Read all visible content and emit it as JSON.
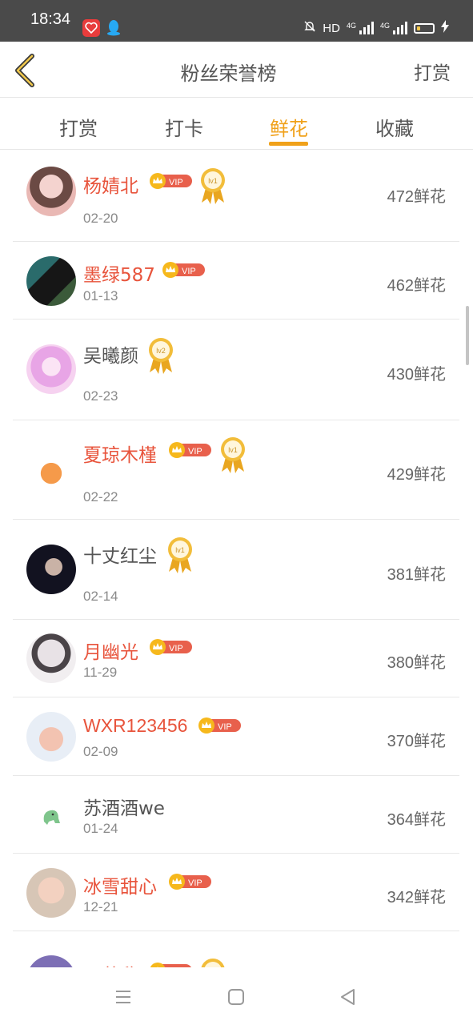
{
  "status_bar": {
    "time": "18:34",
    "hd_label": "HD",
    "signal1_label": "4G",
    "signal2_label": "4G",
    "icons": [
      "app-badge-icon",
      "qq-icon",
      "mute-bell-icon",
      "signal-icon",
      "battery-icon",
      "charging-icon"
    ]
  },
  "header": {
    "title": "粉丝荣誉榜",
    "action_label": "打赏",
    "back_icon": "chevron-left-icon"
  },
  "tabs": [
    {
      "label": "打赏",
      "active": false
    },
    {
      "label": "打卡",
      "active": false
    },
    {
      "label": "鲜花",
      "active": true
    },
    {
      "label": "收藏",
      "active": false
    }
  ],
  "accent_color": "#f0a11a",
  "vip_name_color": "#e8543c",
  "vip_badge_label": "VIP",
  "unit": "鲜花",
  "fans": [
    {
      "name": "杨婧北",
      "date": "02-20",
      "count": "472",
      "vip": true,
      "medal": "lv1"
    },
    {
      "name": "墨绿587",
      "date": "01-13",
      "count": "462",
      "vip": true,
      "medal": ""
    },
    {
      "name": "吴曦颜",
      "date": "02-23",
      "count": "430",
      "vip": false,
      "medal": "lv2"
    },
    {
      "name": "夏琼木槿",
      "date": "02-22",
      "count": "429",
      "vip": true,
      "medal": "lv1"
    },
    {
      "name": "十丈红尘",
      "date": "02-14",
      "count": "381",
      "vip": false,
      "medal": "lv1"
    },
    {
      "name": "月幽光",
      "date": "11-29",
      "count": "380",
      "vip": true,
      "medal": ""
    },
    {
      "name": "WXR123456",
      "date": "02-09",
      "count": "370",
      "vip": true,
      "medal": ""
    },
    {
      "name": "苏酒酒we",
      "date": "01-24",
      "count": "364",
      "vip": false,
      "medal": ""
    },
    {
      "name": "冰雪甜心",
      "date": "12-21",
      "count": "342",
      "vip": true,
      "medal": ""
    },
    {
      "name": "田苏欣",
      "date": "",
      "count": "",
      "vip": true,
      "medal": "lv1"
    }
  ],
  "nav_bar": {
    "icons": [
      "menu-icon",
      "home-square-icon",
      "back-triangle-icon"
    ]
  }
}
